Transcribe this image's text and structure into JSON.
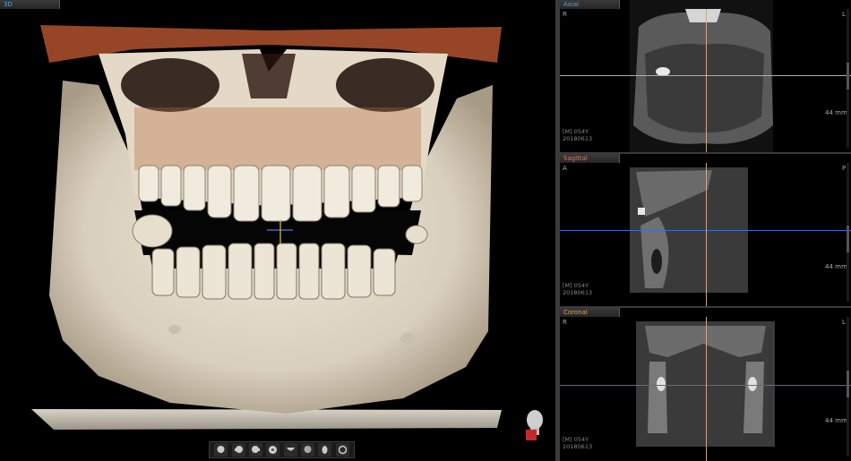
{
  "views": {
    "threed": {
      "tab": "3D"
    },
    "axial": {
      "tab": "Axial",
      "top_left": "R",
      "right": "L",
      "scale": "44 mm",
      "info1": "[M] 054Y",
      "info2": "20180613"
    },
    "sagittal": {
      "tab": "Sagittal",
      "top_left": "A",
      "right": "P",
      "scale": "44 mm",
      "info1": "[M] 054Y",
      "info2": "20180613"
    },
    "coronal": {
      "tab": "Coronal",
      "top_left": "R",
      "right": "L",
      "scale": "44 mm",
      "info1": "[M] 054Y",
      "info2": "20180613"
    }
  },
  "toolbar": {
    "buttons": [
      "view-front-icon",
      "view-left-icon",
      "view-right-icon",
      "view-top-icon",
      "view-bottom-icon",
      "view-back-icon",
      "view-oblique-icon",
      "reset-view-icon"
    ]
  },
  "colors": {
    "axial": "#5aa0e0",
    "sagittal": "#e07a5a",
    "coronal": "#e0a040",
    "crosshair_h": "#3a6fcc",
    "crosshair_v": "#c9a98a",
    "bone": "#e6ddcc"
  }
}
